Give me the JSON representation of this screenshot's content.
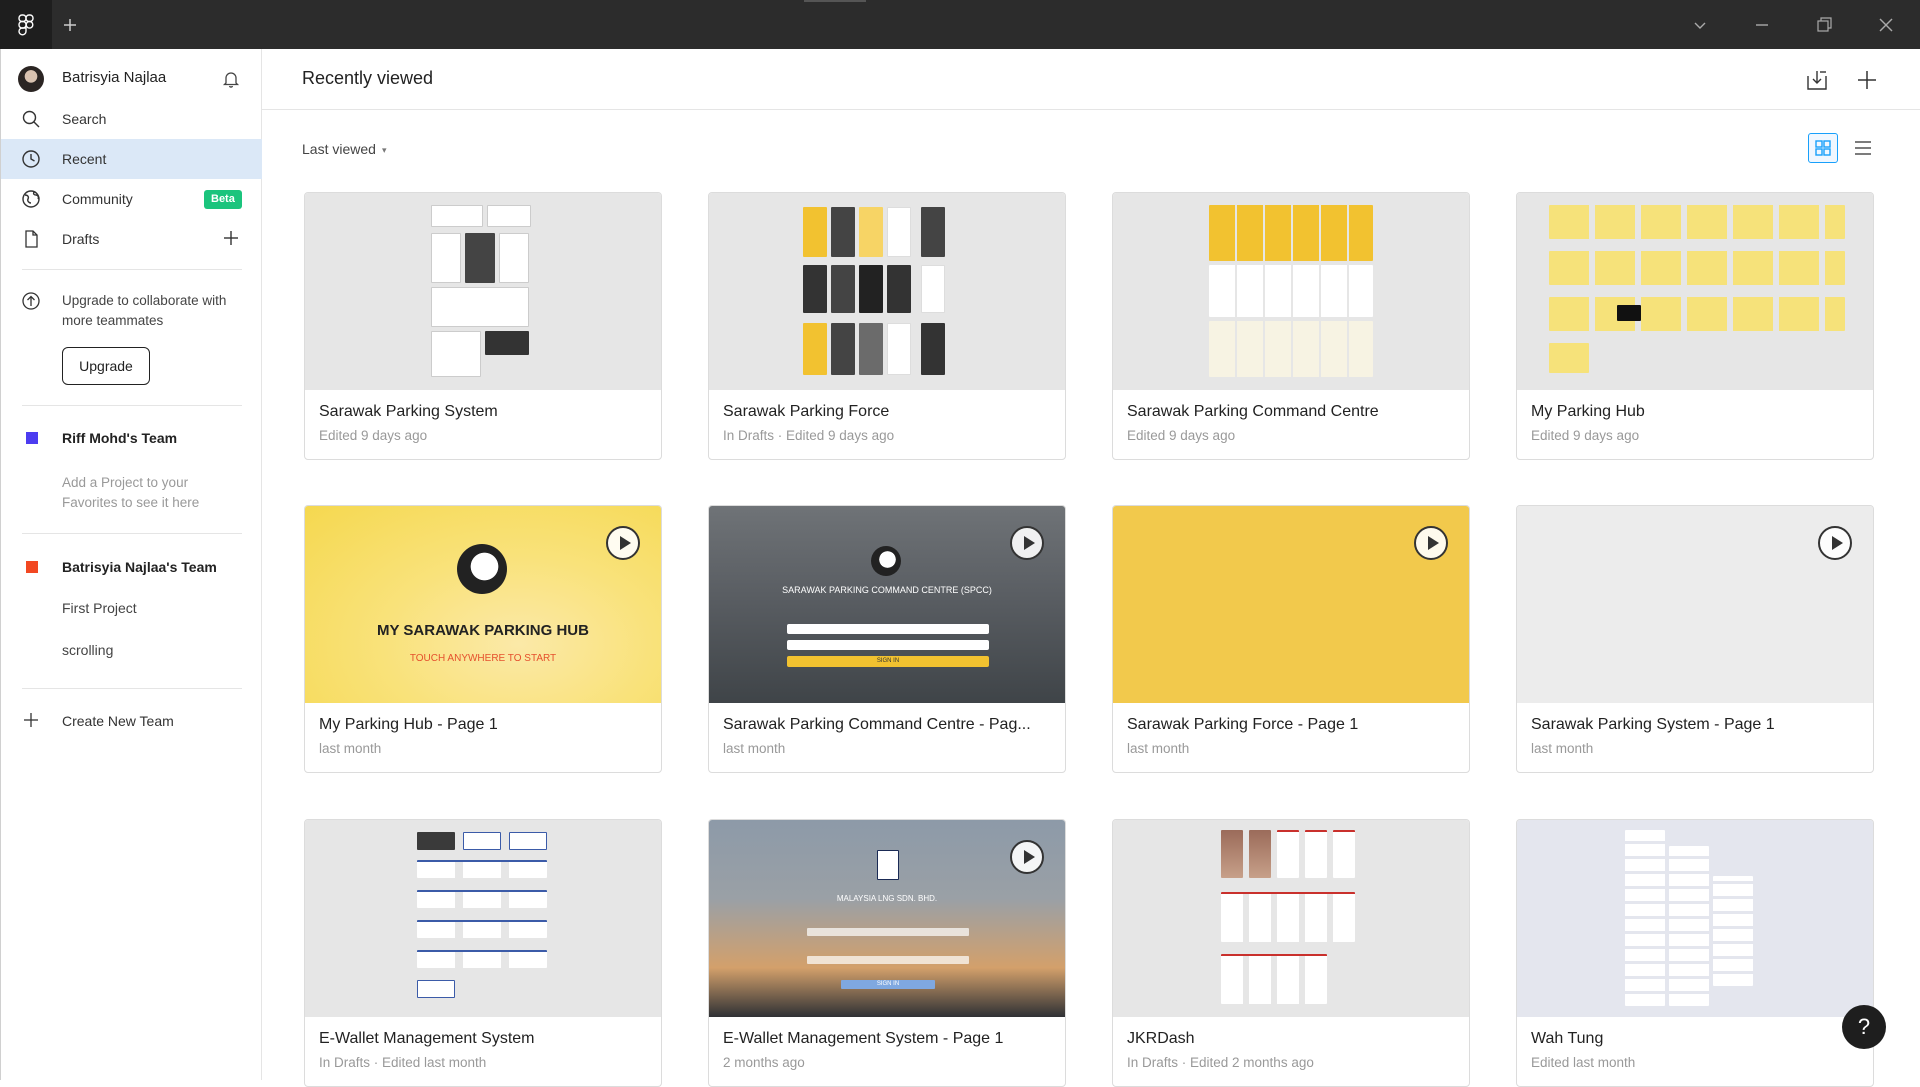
{
  "sidebar": {
    "user": {
      "name": "Batrisyia Najlaa"
    },
    "nav": [
      {
        "label": "Search",
        "icon": "search-icon"
      },
      {
        "label": "Recent",
        "icon": "clock-icon",
        "active": true
      },
      {
        "label": "Community",
        "icon": "globe-icon",
        "badge": "Beta"
      },
      {
        "label": "Drafts",
        "icon": "file-icon"
      }
    ],
    "upgrade": {
      "text": "Upgrade to collaborate with more teammates",
      "button": "Upgrade"
    },
    "teams": [
      {
        "name": "Riff Mohd's Team",
        "color": "#4c3cf0",
        "hint": "Add a Project to your Favorites to see it here"
      },
      {
        "name": "Batrisyia Najlaa's Team",
        "color": "#f24822",
        "projects": [
          "First Project",
          "scrolling"
        ]
      }
    ],
    "create_team": "Create New Team"
  },
  "main": {
    "title": "Recently viewed",
    "sort_label": "Last viewed",
    "files": [
      {
        "title": "Sarawak Parking System",
        "meta": "Edited 9 days ago",
        "prototype": false
      },
      {
        "title": "Sarawak Parking Force",
        "meta": "In Drafts · Edited 9 days ago",
        "prototype": false
      },
      {
        "title": "Sarawak Parking Command Centre",
        "meta": "Edited 9 days ago",
        "prototype": false
      },
      {
        "title": "My Parking Hub",
        "meta": "Edited 9 days ago",
        "prototype": false
      },
      {
        "title": "My Parking Hub - Page 1",
        "meta": "last month",
        "prototype": true,
        "thumb_text": "MY SARAWAK PARKING HUB",
        "thumb_sub": "TOUCH ANYWHERE TO START"
      },
      {
        "title": "Sarawak Parking Command Centre - Pag...",
        "meta": "last month",
        "prototype": true,
        "thumb_text": "SARAWAK PARKING COMMAND CENTRE (SPCC)",
        "thumb_sub": "SIGN IN"
      },
      {
        "title": "Sarawak Parking Force - Page 1",
        "meta": "last month",
        "prototype": true
      },
      {
        "title": "Sarawak Parking System - Page 1",
        "meta": "last month",
        "prototype": true
      },
      {
        "title": "E-Wallet Management System",
        "meta": "In Drafts · Edited last month",
        "prototype": false
      },
      {
        "title": "E-Wallet Management System - Page 1",
        "meta": "2 months ago",
        "prototype": true,
        "thumb_text": "MALAYSIA LNG SDN. BHD.",
        "thumb_sub": "SIGN IN"
      },
      {
        "title": "JKRDash",
        "meta": "In Drafts · Edited 2 months ago",
        "prototype": false
      },
      {
        "title": "Wah Tung",
        "meta": "Edited last month",
        "prototype": false
      }
    ]
  },
  "help_label": "?",
  "colors": {
    "accent": "#18a0fb",
    "selected_bg": "#dbe8f7",
    "beta": "#1bc47d",
    "titlebar": "#2c2c2c"
  }
}
